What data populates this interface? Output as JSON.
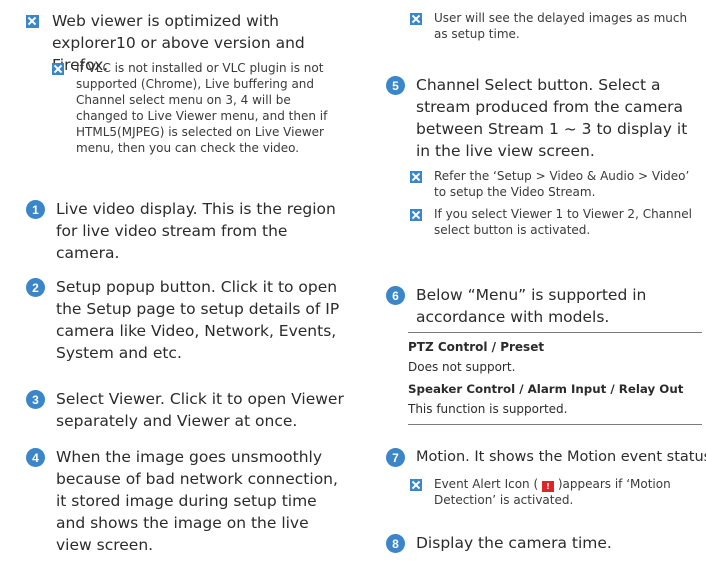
{
  "left": {
    "intro_bullet": "Web viewer is optimized with explorer10 or above version and Firefox.",
    "intro_note": "If VLC is not installed or VLC plugin is not supported (Chrome), Live buffering and Channel select menu on 3, 4 will be changed to Live Viewer menu, and then if HTML5(MJPEG) is selected on Live Viewer menu, then you can check the video.",
    "item1_num": "1",
    "item1": "Live video display. This is the region for live video stream from the camera.",
    "item2_num": "2",
    "item2": "Setup popup button. Click it to open the Setup page to setup details of IP camera like Video, Network, Events, System and etc.",
    "item3_num": "3",
    "item3": "Select Viewer. Click it to open Viewer separately and Viewer at once.",
    "item4_num": "4",
    "item4": "When the image goes unsmoothly because of bad network connection, it stored image during setup time and shows the image on the live view screen."
  },
  "right": {
    "top_note": "User will see the delayed images as much as setup time.",
    "item5_num": "5",
    "item5": "Channel Select button. Select a stream produced from the camera between Stream 1 ~ 3 to display it in the live view screen.",
    "item5_note1": "Refer the ‘Setup > Video & Audio > Video’ to setup the Video Stream.",
    "item5_note2": "If you select Viewer 1 to Viewer 2, Channel select button is activated.",
    "item6_num": "6",
    "item6": "Below “Menu” is supported in accordance with models.",
    "table": {
      "row1_head": "PTZ Control / Preset",
      "row1_text": "Does not support.",
      "row2_head": "Speaker Control / Alarm Input / Relay Out",
      "row2_text": "This function is supported."
    },
    "item7_num": "7",
    "item7": "Motion. It shows the Motion event status.",
    "item7_note_pre": "Event Alert Icon (",
    "item7_icon": "!",
    "item7_note_post": ")appears if ‘Motion Detection’ is activated.",
    "item8_num": "8",
    "item8": "Display the camera time."
  },
  "colors": {
    "accent": "#3a86c8",
    "alert": "#d9262b"
  }
}
